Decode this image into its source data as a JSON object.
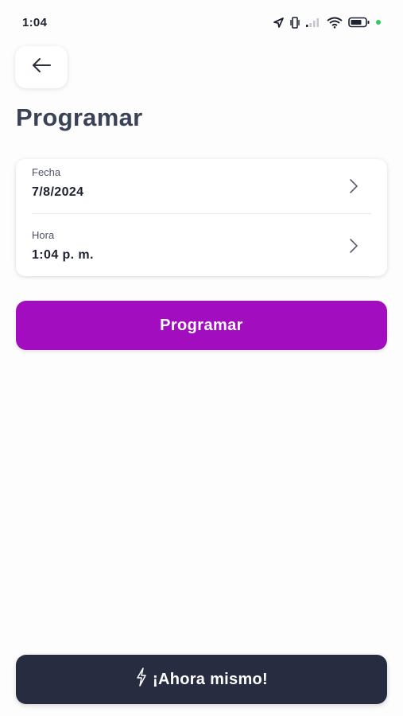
{
  "status_bar": {
    "time": "1:04",
    "icons": [
      "location-arrow-icon",
      "vibrate-icon",
      "signal-icon",
      "wifi-icon",
      "battery-icon",
      "privacy-dot"
    ]
  },
  "header": {
    "back_icon": "arrow-left-icon",
    "title": "Programar"
  },
  "schedule": {
    "date": {
      "label": "Fecha",
      "value": "7/8/2024",
      "icon": "chevron-right-icon"
    },
    "time": {
      "label": "Hora",
      "value": "1:04 p. m.",
      "icon": "chevron-right-icon"
    }
  },
  "actions": {
    "schedule_label": "Programar",
    "now_label": "¡Ahora mismo!",
    "now_icon": "lightning-icon"
  },
  "colors": {
    "primary": "#a20dbf",
    "dark_button": "#272c40",
    "title": "#3a4257",
    "status_dot": "#34c759"
  }
}
